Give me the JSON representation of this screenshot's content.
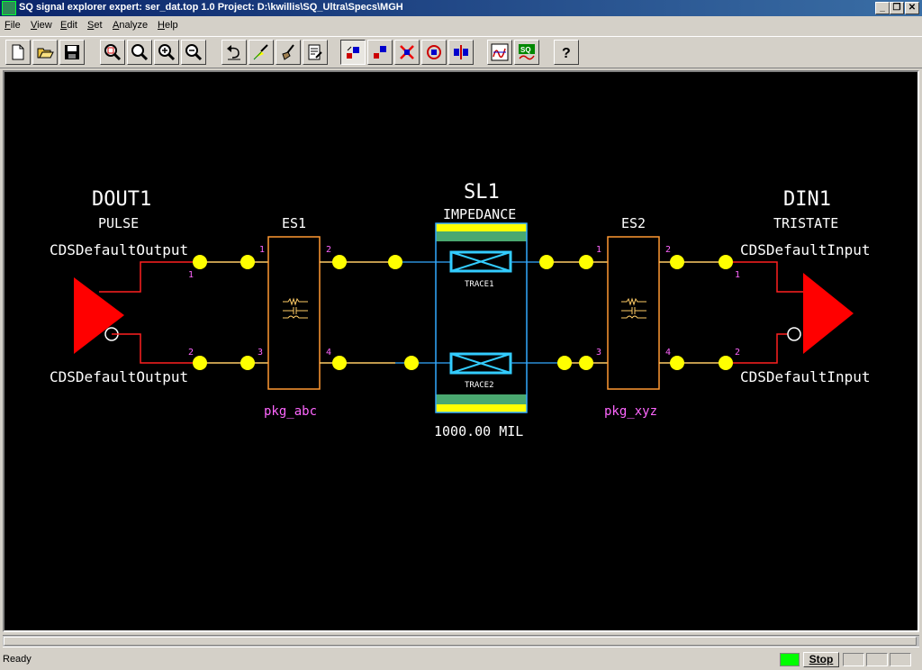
{
  "window": {
    "title": "SQ signal explorer expert: ser_dat.top 1.0  Project: D:\\kwillis\\SQ_Ultra\\Specs\\MGH",
    "controls": [
      "minimize-icon",
      "restore-icon",
      "close-icon"
    ]
  },
  "menu": [
    "File",
    "View",
    "Edit",
    "Set",
    "Analyze",
    "Help"
  ],
  "toolbar": {
    "buttons": [
      "new-file-icon",
      "open-folder-icon",
      "save-icon",
      "zoom-fit-icon",
      "zoom-area-icon",
      "zoom-in-icon",
      "zoom-out-icon",
      "undo-icon",
      "highlight-icon",
      "broom-icon",
      "report-icon",
      "add-part-icon",
      "move-part-icon",
      "delete-icon",
      "rotate-icon",
      "mirror-icon",
      "waveform-icon",
      "sq-simulate-icon",
      "help-icon"
    ]
  },
  "schematic": {
    "driver": {
      "refdes": "DOUT1",
      "model": "PULSE",
      "io_top": "CDSDefaultOutput",
      "io_bottom": "CDSDefaultOutput",
      "pins": [
        "1",
        "2"
      ]
    },
    "es1": {
      "refdes": "ES1",
      "package": "pkg_abc",
      "pins": [
        "1",
        "2",
        "3",
        "4"
      ]
    },
    "sl1": {
      "refdes": "SL1",
      "mode": "IMPEDANCE",
      "length": "1000.00 MIL",
      "traces": [
        "TRACE1",
        "TRACE2"
      ]
    },
    "es2": {
      "refdes": "ES2",
      "package": "pkg_xyz",
      "pins": [
        "1",
        "2",
        "3",
        "4"
      ]
    },
    "receiver": {
      "refdes": "DIN1",
      "model": "TRISTATE",
      "io_top": "CDSDefaultInput",
      "io_bottom": "CDSDefaultInput",
      "pins": [
        "1",
        "2"
      ]
    },
    "colors": {
      "background": "#000000",
      "node": "#ffff00",
      "buffer": "#ff0000",
      "net": "#ffcc66",
      "line_net": "#33aaff",
      "trace": "#33ccff",
      "pin_text": "#ff66ff"
    }
  },
  "status": {
    "text": "Ready",
    "stop_label": "Stop",
    "indicator_color": "#00ff00"
  }
}
